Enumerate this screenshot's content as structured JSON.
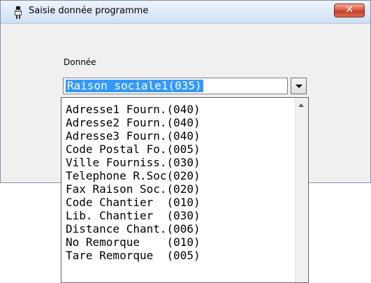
{
  "window": {
    "title": "Saisie donnée programme",
    "close_label": "✕"
  },
  "form": {
    "label": "Donnée",
    "selected_value": "Raison sociale1(035)"
  },
  "dropdown": {
    "items": [
      "Adresse1 Fourn.(040)",
      "Adresse2 Fourn.(040)",
      "Adresse3 Fourn.(040)",
      "Code Postal Fo.(005)",
      "Ville Fourniss.(030)",
      "Telephone R.Soc(020)",
      "Fax Raison Soc.(020)",
      "Code Chantier  (010)",
      "Lib. Chantier  (030)",
      "Distance Chant.(006)",
      "No Remorque    (010)",
      "Tare Remorque  (005)"
    ]
  },
  "icons": {
    "app": "person-icon",
    "close": "close-icon",
    "dropdown": "chevron-down-icon",
    "scroll_up": "scroll-up-icon"
  }
}
